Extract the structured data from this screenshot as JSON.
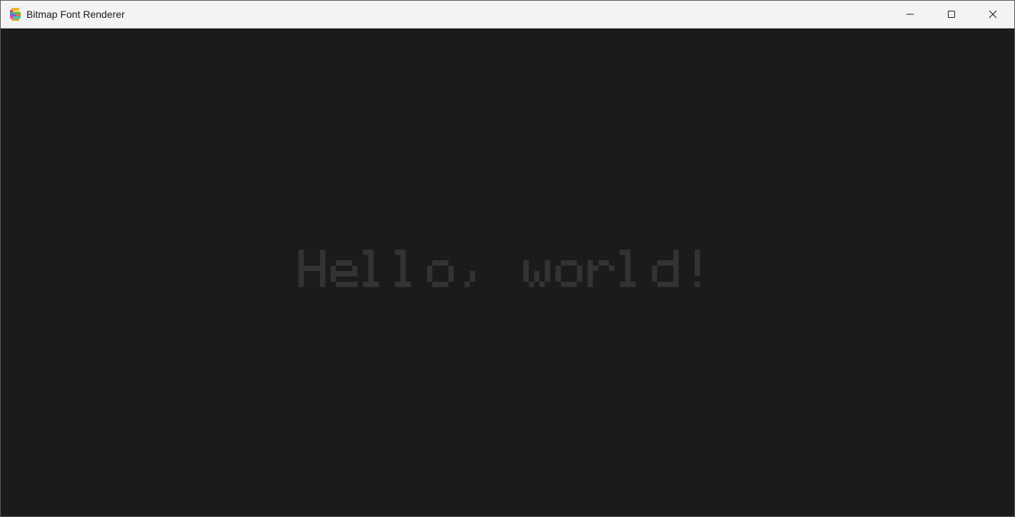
{
  "window": {
    "title": "Bitmap Font Renderer",
    "app_icon": "colorful-stack-app-icon",
    "controls": {
      "minimize_icon": "minimize-icon",
      "maximize_icon": "maximize-icon",
      "close_icon": "close-icon"
    }
  },
  "canvas": {
    "background_color": "#1b1b1b",
    "text": "Hello, world!",
    "text_color": "#333333",
    "font_style": "pixel-bitmap"
  }
}
